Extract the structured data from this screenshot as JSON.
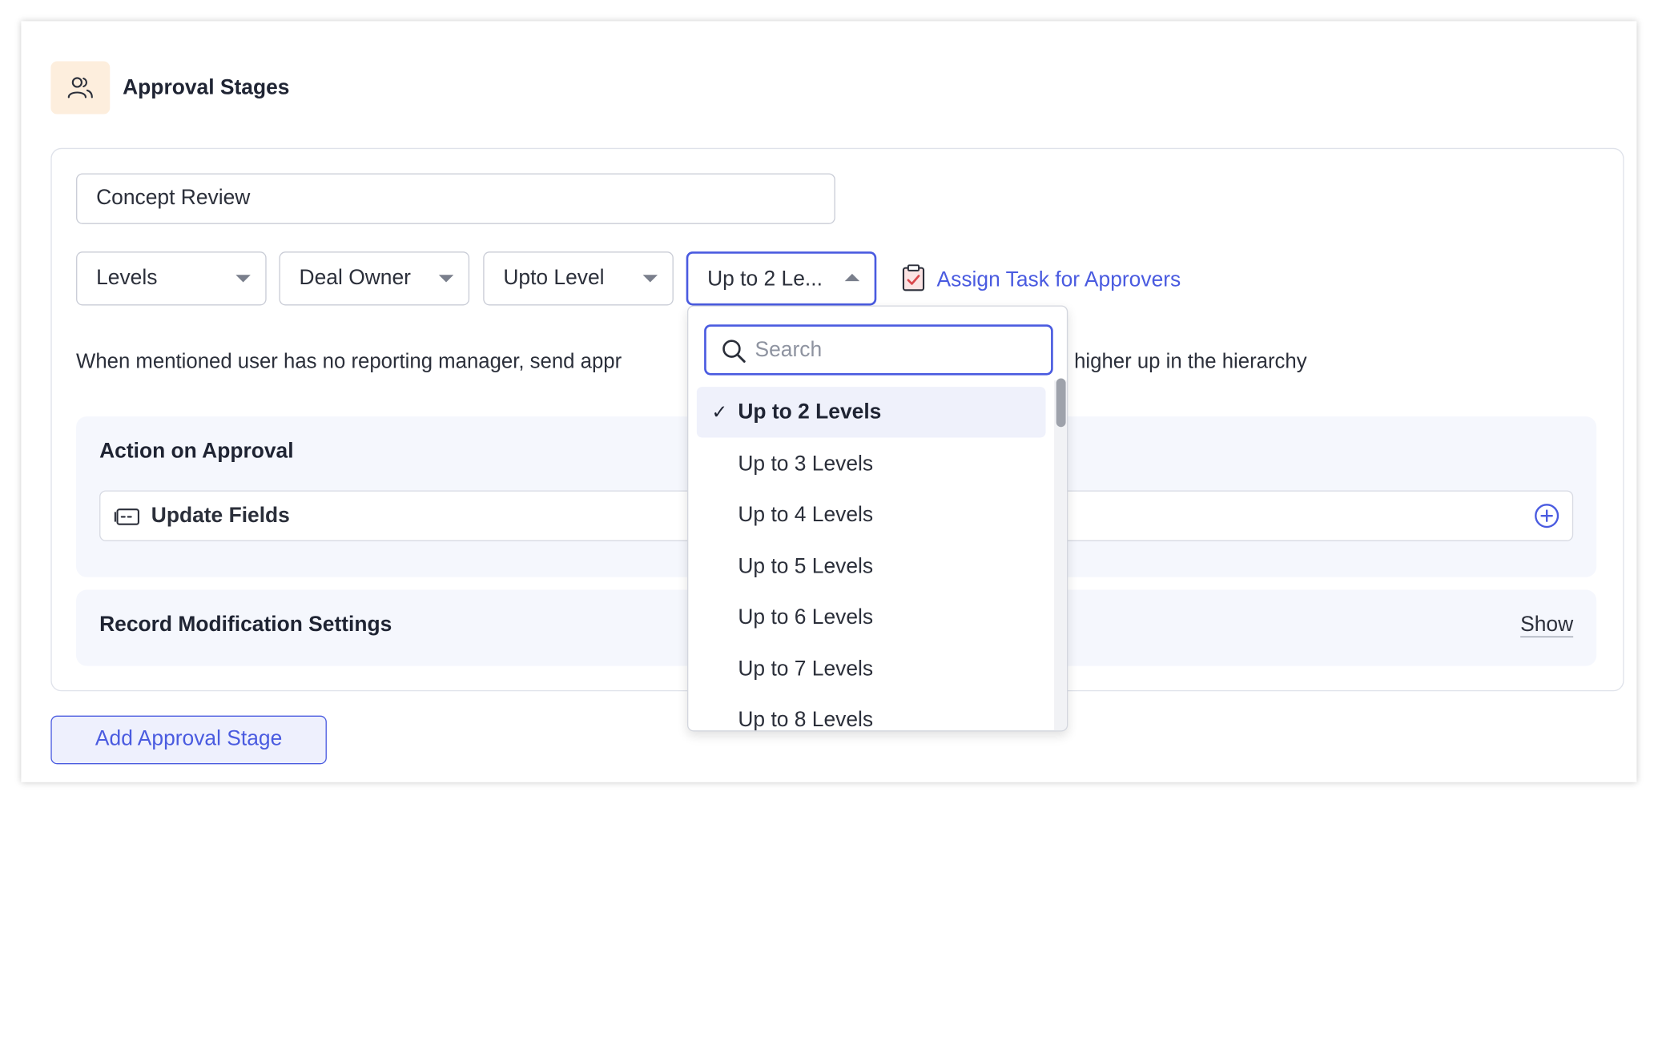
{
  "header": {
    "title": "Approval Stages",
    "icon": "users-icon"
  },
  "stage": {
    "name_value": "Concept Review",
    "dropdowns": {
      "type": "Levels",
      "owner": "Deal Owner",
      "condition": "Upto Level",
      "levels": "Up to 2 Le..."
    },
    "assign_task_label": "Assign Task for Approvers",
    "note_before": "When mentioned user has no reporting manager, send appr",
    "note_after": "higher up in the hierarchy"
  },
  "action_on_approval": {
    "title": "Action on Approval",
    "update_fields_label": "Update Fields"
  },
  "record_modification": {
    "title": "Record Modification Settings",
    "show_label": "Show"
  },
  "add_stage_label": "Add Approval Stage",
  "levels_menu": {
    "search_placeholder": "Search",
    "selected": "Up to 2 Levels",
    "items": [
      "Up to 2 Levels",
      "Up to 3 Levels",
      "Up to 4 Levels",
      "Up to 5 Levels",
      "Up to 6 Levels",
      "Up to 7 Levels",
      "Up to 8 Levels"
    ]
  },
  "colors": {
    "accent": "#4a5be0",
    "header_icon_bg": "#fdeedd",
    "panel_bg": "#f5f7fd"
  }
}
